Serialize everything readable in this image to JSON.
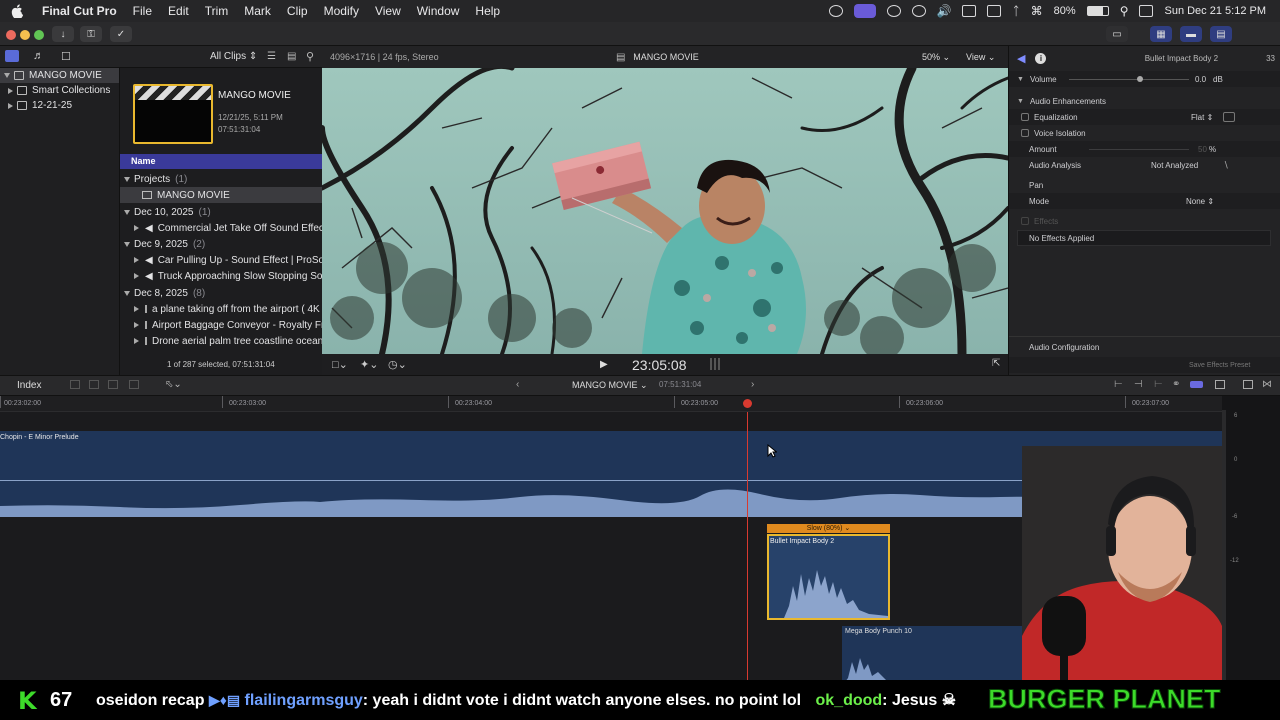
{
  "menubar": {
    "app_name": "Final Cut Pro",
    "menus": [
      "File",
      "Edit",
      "Trim",
      "Mark",
      "Clip",
      "Modify",
      "View",
      "Window",
      "Help"
    ],
    "battery": "80%",
    "datetime": "Sun Dec 21  5:12 PM"
  },
  "library_header": {
    "filter": "All Clips"
  },
  "libraries": {
    "items": [
      {
        "label": "MANGO MOVIE",
        "icon": "library-icon",
        "expanded": true,
        "selected": true
      },
      {
        "label": "Smart Collections",
        "icon": "folder-icon",
        "expanded": false
      },
      {
        "label": "12-21-25",
        "icon": "event-icon",
        "expanded": false
      }
    ]
  },
  "browser": {
    "project_title": "MANGO MOVIE",
    "project_date": "12/21/25, 5:11 PM",
    "project_duration": "07:51:31:04",
    "column_header": "Name",
    "groups": [
      {
        "label": "Projects",
        "count": "(1)",
        "items": [
          "MANGO MOVIE"
        ]
      },
      {
        "label": "Dec 10, 2025",
        "count": "(1)",
        "items": [
          "Commercial Jet Take Off Sound Effect"
        ]
      },
      {
        "label": "Dec 9, 2025",
        "count": "(2)",
        "items": [
          "Car Pulling Up - Sound Effect  |  ProSoun",
          "Truck Approaching Slow Stopping Sound"
        ]
      },
      {
        "label": "Dec 8, 2025",
        "count": "(8)",
        "items": [
          "a plane taking off from the airport ( 4K ro",
          "Airport Baggage Conveyor - Royalty Free",
          "Drone aerial palm tree coastline ocean be"
        ]
      }
    ],
    "status": "1 of 287 selected, 07:51:31:04"
  },
  "viewer": {
    "format": "4096×1716 | 24 fps, Stereo",
    "title": "MANGO MOVIE",
    "zoom": "50%",
    "view_menu": "View",
    "timecode": "23:05:08"
  },
  "inspector": {
    "clip_name": "Bullet Impact Body 2",
    "duration_suffix": "33",
    "volume_label": "Volume",
    "volume_value": "0.0",
    "volume_unit": "dB",
    "audio_enhancements": "Audio Enhancements",
    "equalization_label": "Equalization",
    "equalization_value": "Flat",
    "voice_isolation_label": "Voice Isolation",
    "amount_label": "Amount",
    "amount_value": "50",
    "amount_unit": "%",
    "audio_analysis_label": "Audio Analysis",
    "audio_analysis_value": "Not Analyzed",
    "pan_label": "Pan",
    "mode_label": "Mode",
    "mode_value": "None",
    "effects_label": "Effects",
    "no_effects": "No Effects Applied",
    "audio_configuration": "Audio Configuration",
    "save_preset": "Save Effects Preset"
  },
  "timeline_header": {
    "index_label": "Index",
    "project_name": "MANGO MOVIE",
    "project_duration": "07:51:31:04"
  },
  "ruler": {
    "ticks": [
      "00:23:02:00",
      "00:23:03:00",
      "00:23:04:00",
      "00:23:05:00",
      "00:23:06:00",
      "00:23:07:00"
    ]
  },
  "timeline": {
    "music_clip": "Chopin - E Minor Prelude",
    "retime_label": "Slow (80%)",
    "sfx_clip_1": "Bullet Impact Body 2",
    "sfx_clip_2": "Mega Body Punch 10"
  },
  "meters": {
    "labels": [
      "6",
      "0",
      "-6",
      "-12"
    ]
  },
  "chat": {
    "k_count": "67",
    "prev_message": "oseidon recap",
    "user1": "flailingarmsguy",
    "msg1": ": yeah i didnt vote i didnt watch anyone elses. no point lol",
    "user2": "ok_dood",
    "msg2": ": Jesus",
    "banner": "BURGER PLANET"
  },
  "colors": {
    "selection_blue": "#3a3a9a",
    "clip_blue": "#1f3558",
    "retime_orange": "#e08a1e",
    "playhead_red": "#d83a30",
    "chat_user1": "#6fa0ff",
    "chat_user2": "#6cf04a",
    "banner_green": "#3ddb2a"
  }
}
